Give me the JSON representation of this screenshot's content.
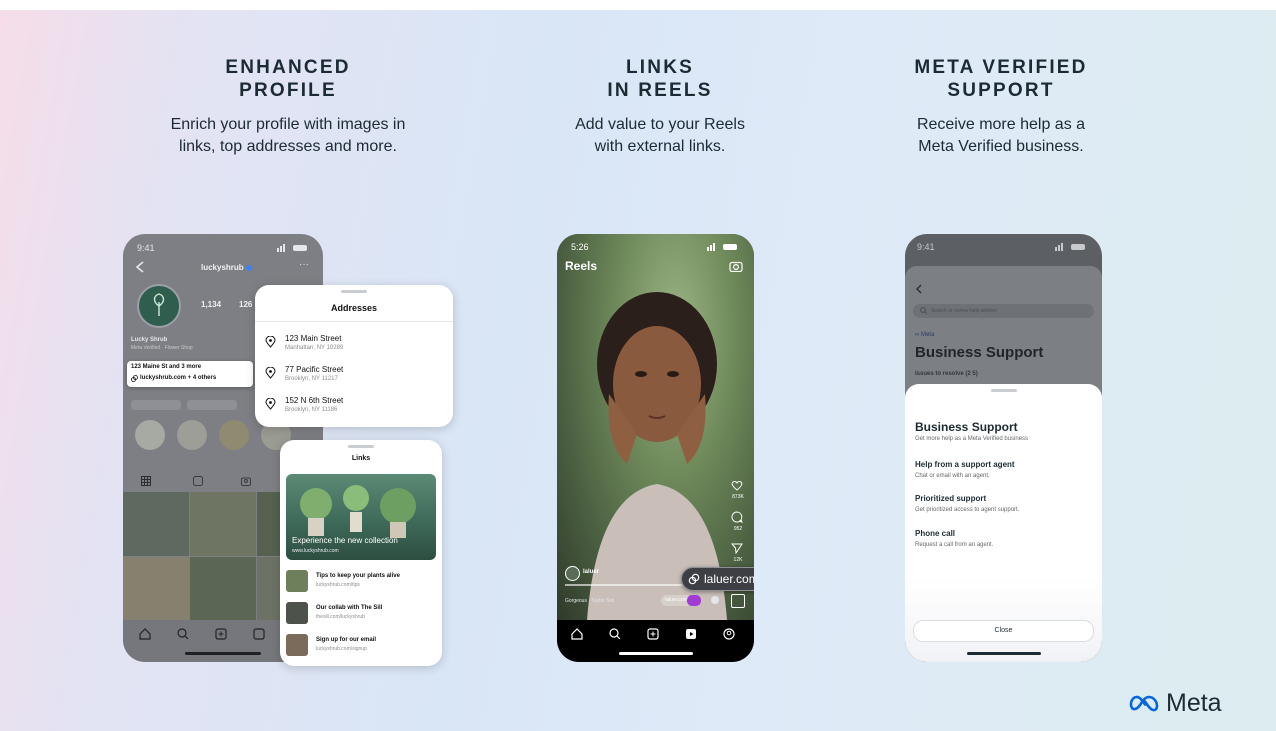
{
  "columns": [
    {
      "title_line1": "ENHANCED",
      "title_line2": "PROFILE",
      "desc_line1": "Enrich your profile with images in",
      "desc_line2": "links, top addresses and more."
    },
    {
      "title_line1": "LINKS",
      "title_line2": "IN REELS",
      "desc_line1": "Add value to your Reels",
      "desc_line2": "with external links."
    },
    {
      "title_line1": "META VERIFIED",
      "title_line2": "SUPPORT",
      "desc_line1": "Receive more help as a",
      "desc_line2": "Meta Verified business."
    }
  ],
  "profile_phone": {
    "time": "9:41",
    "username": "luckyshrub",
    "posts_count": "1,134",
    "followers_partial": "126",
    "name": "Lucky Shrub",
    "category": "Meta Verified · Flower Shop",
    "address_summary": "123 Maine St and 3 more",
    "link_summary": "luckyshrub.com + 4 others"
  },
  "addresses_card": {
    "title": "Addresses",
    "items": [
      {
        "street": "123 Main Street",
        "city": "Manhattan, NY 10289"
      },
      {
        "street": "77 Pacific Street",
        "city": "Brooklyn, NY 11217"
      },
      {
        "street": "152 N 6th Street",
        "city": "Brooklyn, NY 11186"
      }
    ]
  },
  "links_card": {
    "title": "Links",
    "hero_caption": "Experience the new collection",
    "hero_url": "www.luckyshrub.com",
    "items": [
      {
        "title": "Tips to keep your plants alive",
        "url": "luckyshrub.com/tips"
      },
      {
        "title": "Our collab with The Sill",
        "url": "thesill.com/luckyshrub"
      },
      {
        "title": "Sign up for our email",
        "url": "luckyshrub.com/signup"
      }
    ]
  },
  "reels_phone": {
    "time": "5:26",
    "header": "Reels",
    "likes": "873K",
    "comments": "952",
    "shares": "12K",
    "username": "laluer",
    "link_chip": "laluer.com",
    "audio": "Gorgeous · Taylor Swi",
    "audio_link": "laluer.com"
  },
  "support_phone": {
    "time": "9:41",
    "search_placeholder": "Search or review help articles",
    "meta_label": "Meta",
    "page_title": "Business Support",
    "issues_label": "Issues to resolve (2 5)",
    "sheet_title": "Business Support",
    "sheet_subtitle": "Get more help as a Meta Verified business",
    "items": [
      {
        "title": "Help from a support agent",
        "desc": "Chat or email with an agent."
      },
      {
        "title": "Prioritized support",
        "desc": "Get prioritized access to agent support."
      },
      {
        "title": "Phone call",
        "desc": "Request a call from an agent."
      }
    ],
    "close_label": "Close"
  },
  "brand": {
    "logo_text": "Meta"
  },
  "colors": {
    "ink": "#1c2b33",
    "meta_blue": "#0467df",
    "reels_purple": "#a03bd6"
  }
}
